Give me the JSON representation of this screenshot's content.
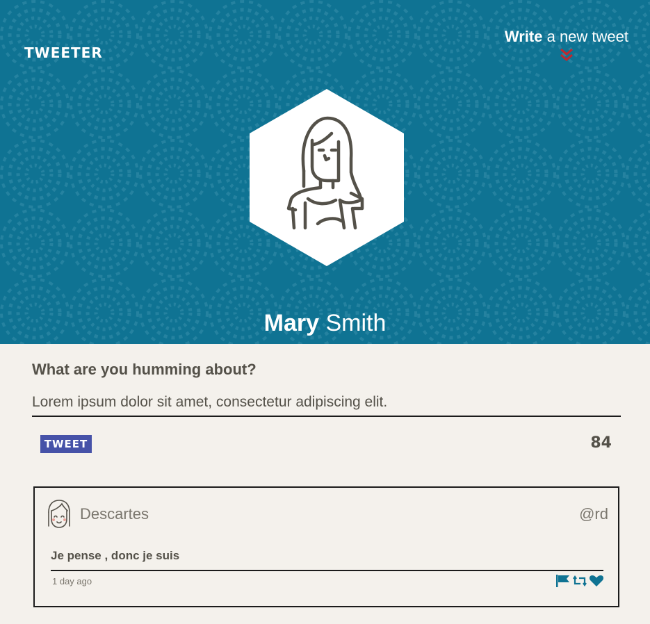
{
  "header": {
    "brand": "TWEETER",
    "compose_bold": "Write",
    "compose_rest": " a new tweet",
    "user_first": "Mary",
    "user_last": " Smith"
  },
  "composer": {
    "label": "What are you humming about?",
    "input_value": "Lorem ipsum dolor sit amet, consectetur adipiscing elit.",
    "button_label": "TWEET",
    "char_counter": "84"
  },
  "tweets": [
    {
      "name": "Descartes",
      "handle": "@rd",
      "text": "Je pense , donc je suis",
      "time": "1 day ago",
      "actions": [
        "flag-icon",
        "retweet-icon",
        "heart-icon"
      ]
    }
  ],
  "colors": {
    "header_bg": "#0f7393",
    "accent_arrows": "#c0282d",
    "tweet_button": "#4652a8",
    "action_icons": "#0f7393",
    "page_bg": "#f4f1ec",
    "text": "#545149"
  }
}
